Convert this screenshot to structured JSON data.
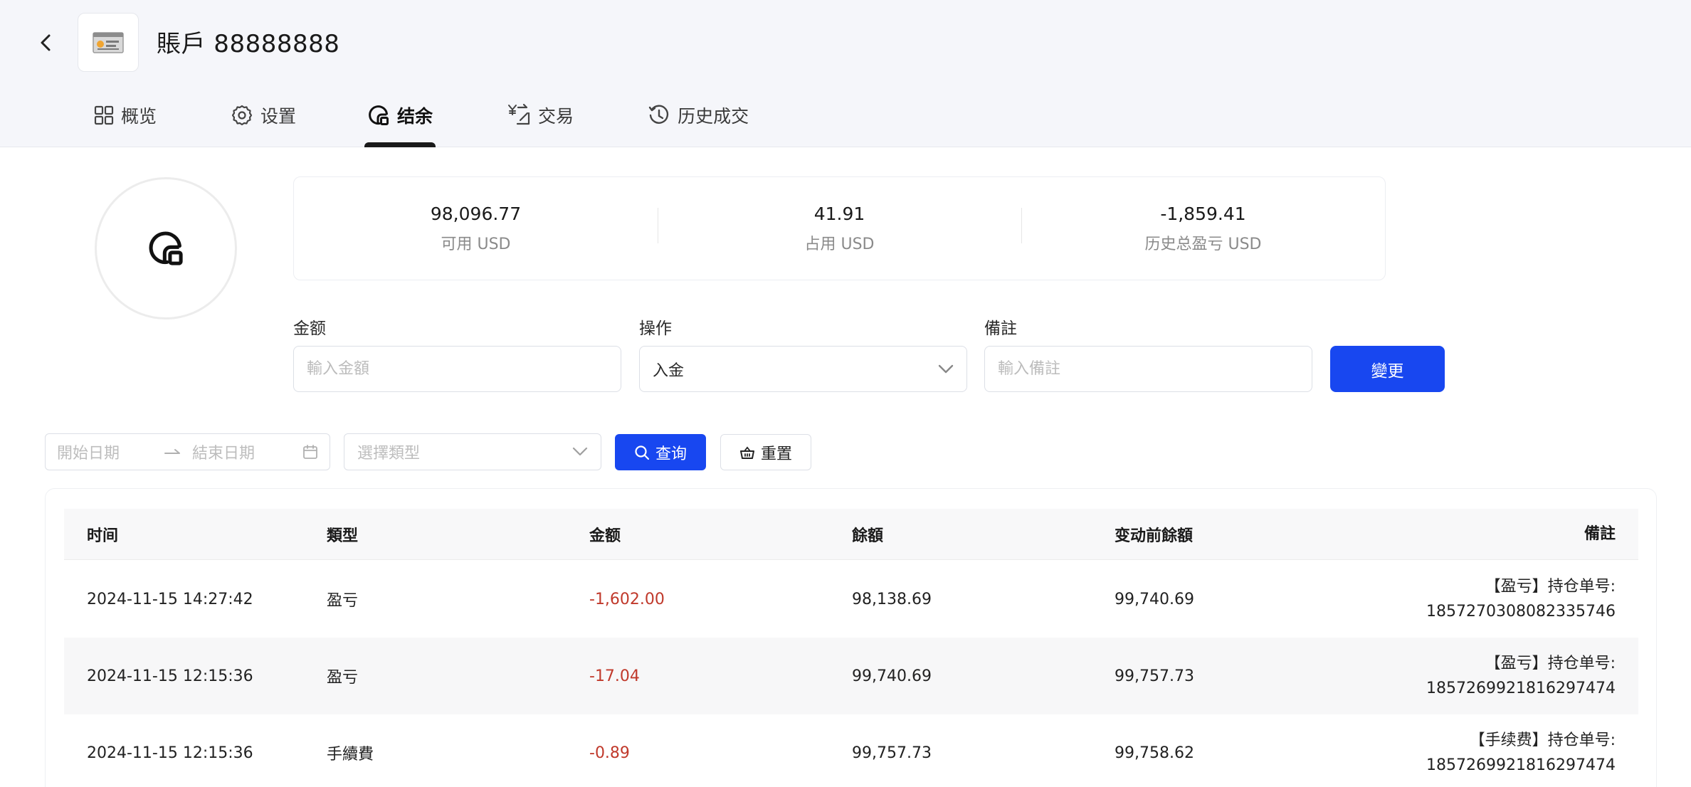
{
  "header": {
    "account_title": "賬戶 88888888",
    "tabs": [
      {
        "label": "概览",
        "icon": "grid-icon",
        "active": false
      },
      {
        "label": "设置",
        "icon": "gear-icon",
        "active": false
      },
      {
        "label": "结余",
        "icon": "balance-icon",
        "active": true
      },
      {
        "label": "交易",
        "icon": "exchange-icon",
        "active": false
      },
      {
        "label": "历史成交",
        "icon": "history-icon",
        "active": false
      }
    ]
  },
  "stats": [
    {
      "value": "98,096.77",
      "label": "可用 USD"
    },
    {
      "value": "41.91",
      "label": "占用 USD"
    },
    {
      "value": "-1,859.41",
      "label": "历史总盈亏 USD"
    }
  ],
  "form": {
    "amount_label": "金额",
    "amount_placeholder": "輸入金額",
    "operation_label": "操作",
    "operation_value": "入金",
    "remark_label": "備註",
    "remark_placeholder": "輸入備註",
    "submit_label": "變更"
  },
  "filters": {
    "start_placeholder": "開始日期",
    "end_placeholder": "結束日期",
    "type_placeholder": "選擇類型",
    "query_label": "查询",
    "reset_label": "重置"
  },
  "table": {
    "columns": [
      "时间",
      "類型",
      "金额",
      "餘額",
      "变动前餘額",
      "備註"
    ],
    "rows": [
      {
        "time": "2024-11-15 14:27:42",
        "type": "盈亏",
        "amount": "-1,602.00",
        "balance": "98,138.69",
        "before": "99,740.69",
        "remark_line1": "【盈亏】持仓单号:",
        "remark_line2": "1857270308082335746"
      },
      {
        "time": "2024-11-15 12:15:36",
        "type": "盈亏",
        "amount": "-17.04",
        "balance": "99,740.69",
        "before": "99,757.73",
        "remark_line1": "【盈亏】持仓单号:",
        "remark_line2": "1857269921816297474"
      },
      {
        "time": "2024-11-15 12:15:36",
        "type": "手續費",
        "amount": "-0.89",
        "balance": "99,757.73",
        "before": "99,758.62",
        "remark_line1": "【手续费】持仓单号:",
        "remark_line2": "1857269921816297474"
      }
    ]
  },
  "colors": {
    "primary": "#1847f0",
    "negative": "#c0392b",
    "header_bg": "#f5f6fa"
  }
}
